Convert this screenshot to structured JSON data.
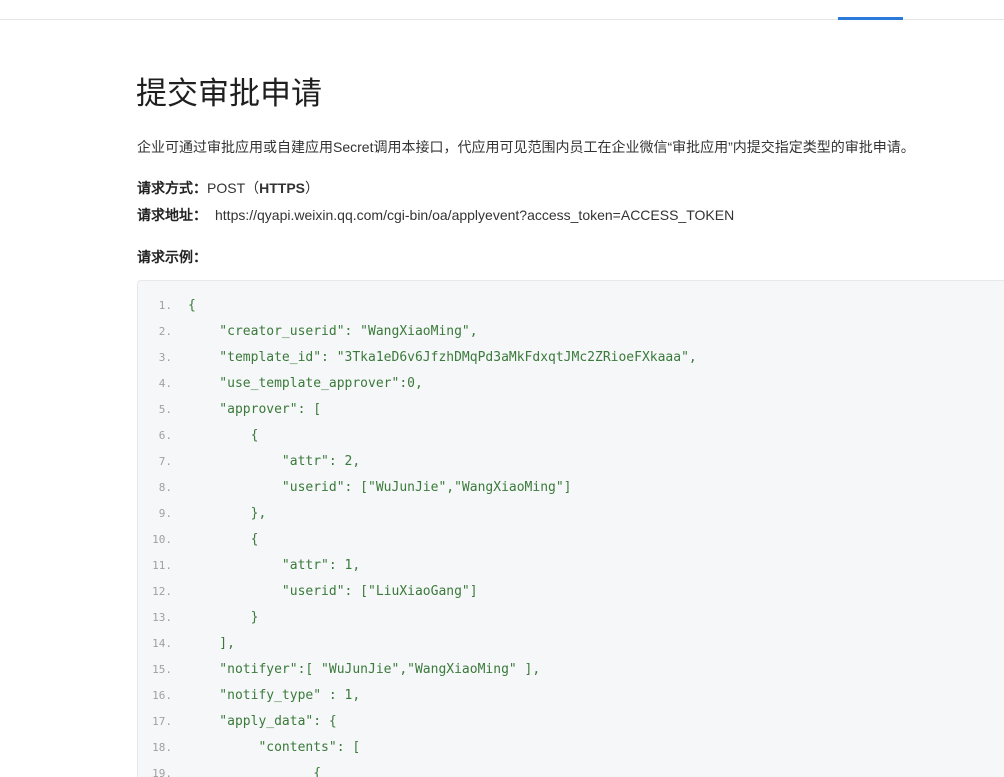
{
  "page": {
    "title": "提交审批申请",
    "description": "企业可通过审批应用或自建应用Secret调用本接口，代应用可见范围内员工在企业微信“审批应用”内提交指定类型的审批申请。",
    "request_method_label": "请求方式：",
    "request_method_value": "POST（",
    "request_method_protocol": "HTTPS",
    "request_method_close": "）",
    "request_url_label": "请求地址：",
    "request_url_value": "https://qyapi.weixin.qq.com/cgi-bin/oa/applyevent?access_token=ACCESS_TOKEN",
    "example_label": "请求示例："
  },
  "colors": {
    "accent": "#2b7ad9",
    "code_bg": "#f6f7f9",
    "code_text": "#3a7a3a",
    "line_number": "#a0a0a0"
  },
  "code_lines": [
    {
      "num": "1.",
      "text": "{"
    },
    {
      "num": "2.",
      "text": "    \"creator_userid\": \"WangXiaoMing\","
    },
    {
      "num": "3.",
      "text": "    \"template_id\": \"3Tka1eD6v6JfzhDMqPd3aMkFdxqtJMc2ZRioeFXkaaa\","
    },
    {
      "num": "4.",
      "text": "    \"use_template_approver\":0,"
    },
    {
      "num": "5.",
      "text": "    \"approver\": ["
    },
    {
      "num": "6.",
      "text": "        {"
    },
    {
      "num": "7.",
      "text": "            \"attr\": 2,"
    },
    {
      "num": "8.",
      "text": "            \"userid\": [\"WuJunJie\",\"WangXiaoMing\"]"
    },
    {
      "num": "9.",
      "text": "        },"
    },
    {
      "num": "10.",
      "text": "        {"
    },
    {
      "num": "11.",
      "text": "            \"attr\": 1,"
    },
    {
      "num": "12.",
      "text": "            \"userid\": [\"LiuXiaoGang\"]"
    },
    {
      "num": "13.",
      "text": "        }"
    },
    {
      "num": "14.",
      "text": "    ],"
    },
    {
      "num": "15.",
      "text": "    \"notifyer\":[ \"WuJunJie\",\"WangXiaoMing\" ],"
    },
    {
      "num": "16.",
      "text": "    \"notify_type\" : 1,"
    },
    {
      "num": "17.",
      "text": "    \"apply_data\": {"
    },
    {
      "num": "18.",
      "text": "         \"contents\": ["
    },
    {
      "num": "19.",
      "text": "                {"
    }
  ]
}
